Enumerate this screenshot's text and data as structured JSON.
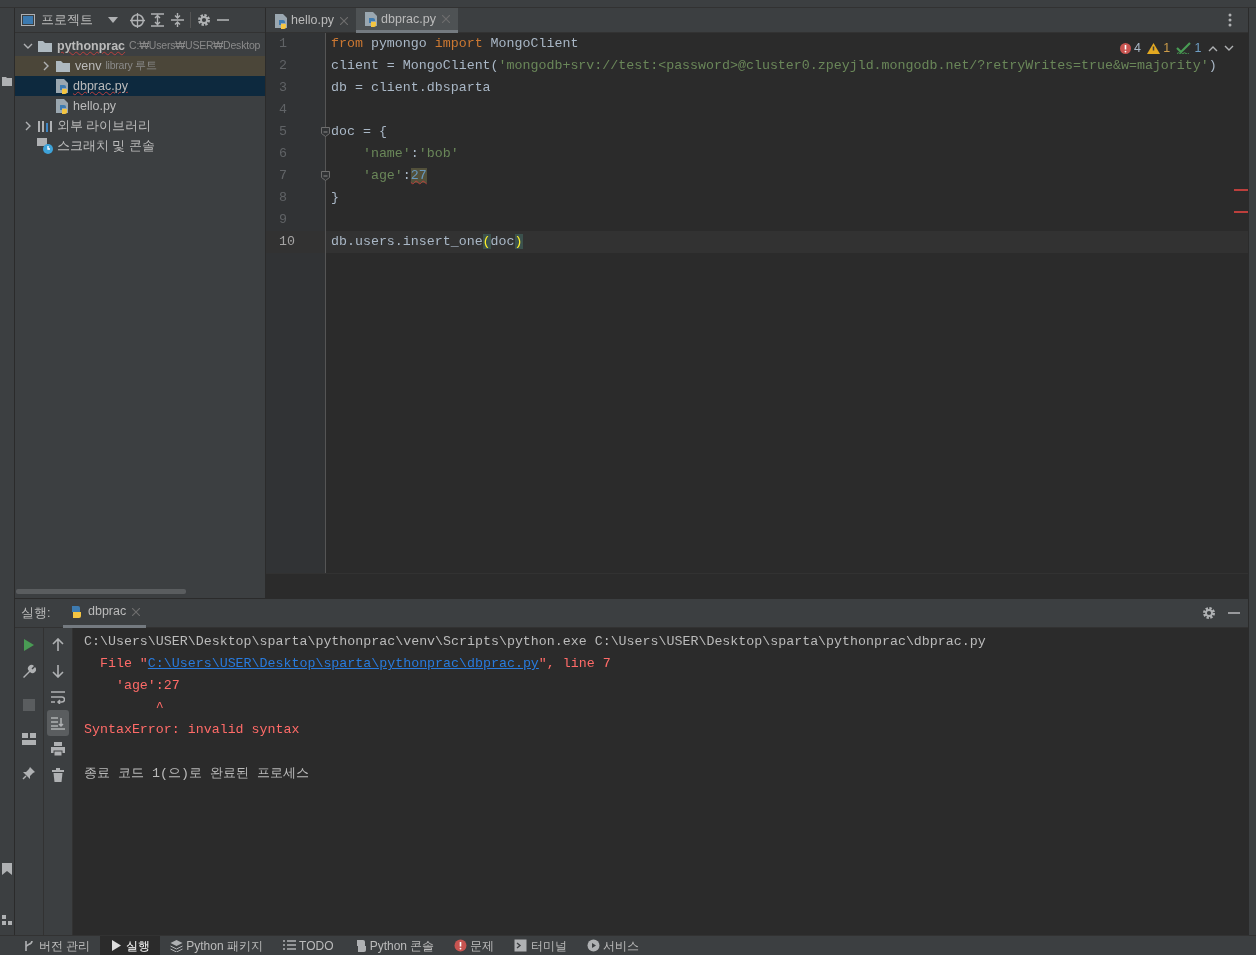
{
  "project_panel": {
    "title": "프로젝트",
    "tree": [
      {
        "label": "pythonprac",
        "detail": "C:₩Users₩USER₩Desktop",
        "kind": "folder",
        "expanded": true,
        "selected": false,
        "hovered": false,
        "typo": true,
        "children": [
          {
            "label": "venv",
            "detail": "library 루트",
            "kind": "folder",
            "expanded": false,
            "selected": false,
            "hovered": true,
            "typo": false
          },
          {
            "label": "dbprac.py",
            "kind": "file",
            "selected": true,
            "hovered": false,
            "typo": true
          },
          {
            "label": "hello.py",
            "kind": "file",
            "selected": false,
            "hovered": false,
            "typo": false
          }
        ]
      },
      {
        "label": "외부 라이브러리",
        "kind": "library",
        "expanded": false,
        "selected": false,
        "hovered": false,
        "typo": false
      },
      {
        "label": "스크래치 및 콘솔",
        "kind": "scratch",
        "selected": false,
        "hovered": false,
        "typo": false
      }
    ]
  },
  "editor": {
    "tabs": [
      {
        "label": "hello.py",
        "selected": false
      },
      {
        "label": "dbprac.py",
        "selected": true
      }
    ],
    "inspections": {
      "errors": "4",
      "warnings": "1",
      "typos": "1"
    },
    "lines": [
      {
        "number": "1",
        "current": false,
        "fold": false,
        "tokens": [
          {
            "t": "from",
            "kind": "kw"
          },
          {
            "t": " pymongo ",
            "kind": "plain"
          },
          {
            "t": "import",
            "kind": "kw"
          },
          {
            "t": " MongoClient",
            "kind": "plain"
          }
        ]
      },
      {
        "number": "2",
        "current": false,
        "fold": false,
        "tokens": [
          {
            "t": "client = MongoClient(",
            "kind": "plain"
          },
          {
            "t": "'mongodb+srv://test:<password>@cluster0.zpeyjld.mongodb.net/?retryWrites=true&w=majority'",
            "kind": "str"
          },
          {
            "t": ")",
            "kind": "plain"
          }
        ]
      },
      {
        "number": "3",
        "current": false,
        "fold": false,
        "tokens": [
          {
            "t": "db = client.dbsparta",
            "kind": "plain"
          }
        ]
      },
      {
        "number": "4",
        "current": false,
        "fold": false
      },
      {
        "number": "5",
        "current": false,
        "fold": true,
        "tokens": [
          {
            "t": "doc = {",
            "kind": "plain"
          }
        ]
      },
      {
        "number": "6",
        "current": false,
        "fold": false,
        "tokens": [
          {
            "t": "    'name'",
            "kind": "str"
          },
          {
            "t": ":",
            "kind": "plain"
          },
          {
            "t": "'bob'",
            "kind": "str"
          }
        ]
      },
      {
        "number": "7",
        "current": false,
        "fold": true,
        "tokens": [
          {
            "t": "    'age'",
            "kind": "str"
          },
          {
            "t": ":",
            "kind": "plain"
          },
          {
            "t": "27",
            "kind": "num",
            "error": true
          }
        ]
      },
      {
        "number": "8",
        "current": false,
        "fold": false,
        "tokens": [
          {
            "t": "}",
            "kind": "plain"
          }
        ]
      },
      {
        "number": "9",
        "current": false,
        "fold": false
      },
      {
        "number": "10",
        "current": true,
        "fold": false,
        "tokens": [
          {
            "t": "db.users.insert_one",
            "kind": "plain"
          },
          {
            "t": "(",
            "kind": "brace"
          },
          {
            "t": "doc",
            "kind": "plain"
          },
          {
            "t": ")",
            "kind": "brace"
          }
        ]
      }
    ]
  },
  "run_panel": {
    "label": "실행:",
    "tabs": [
      {
        "label": "dbprac",
        "selected": true
      }
    ],
    "autoscroll_on": true,
    "console": [
      {
        "kind": "command",
        "text": "C:\\Users\\USER\\Desktop\\sparta\\pythonprac\\venv\\Scripts\\python.exe C:\\Users\\USER\\Desktop\\sparta\\pythonprac\\dbprac.py"
      },
      {
        "kind": "link",
        "prefix": "  File \"",
        "link": "C:\\Users\\USER\\Desktop\\sparta\\pythonprac\\dbprac.py",
        "suffix": "\", line 7"
      },
      {
        "kind": "error",
        "text": "    'age':27"
      },
      {
        "kind": "error",
        "text": "         ^"
      },
      {
        "kind": "error",
        "text": "SyntaxError: invalid syntax"
      },
      {
        "kind": "blank"
      },
      {
        "kind": "plain",
        "text": "종료 코드 1(으)로 완료된 프로세스"
      }
    ]
  },
  "tool_windows": [
    {
      "label": "버전 관리",
      "selected": false
    },
    {
      "label": "실행",
      "selected": true
    },
    {
      "label": "Python 패키지",
      "selected": false
    },
    {
      "label": "TODO",
      "selected": false
    },
    {
      "label": "Python 콘솔",
      "selected": false
    },
    {
      "label": "문제",
      "selected": false
    },
    {
      "label": "터미널",
      "selected": false
    },
    {
      "label": "서비스",
      "selected": false
    }
  ]
}
